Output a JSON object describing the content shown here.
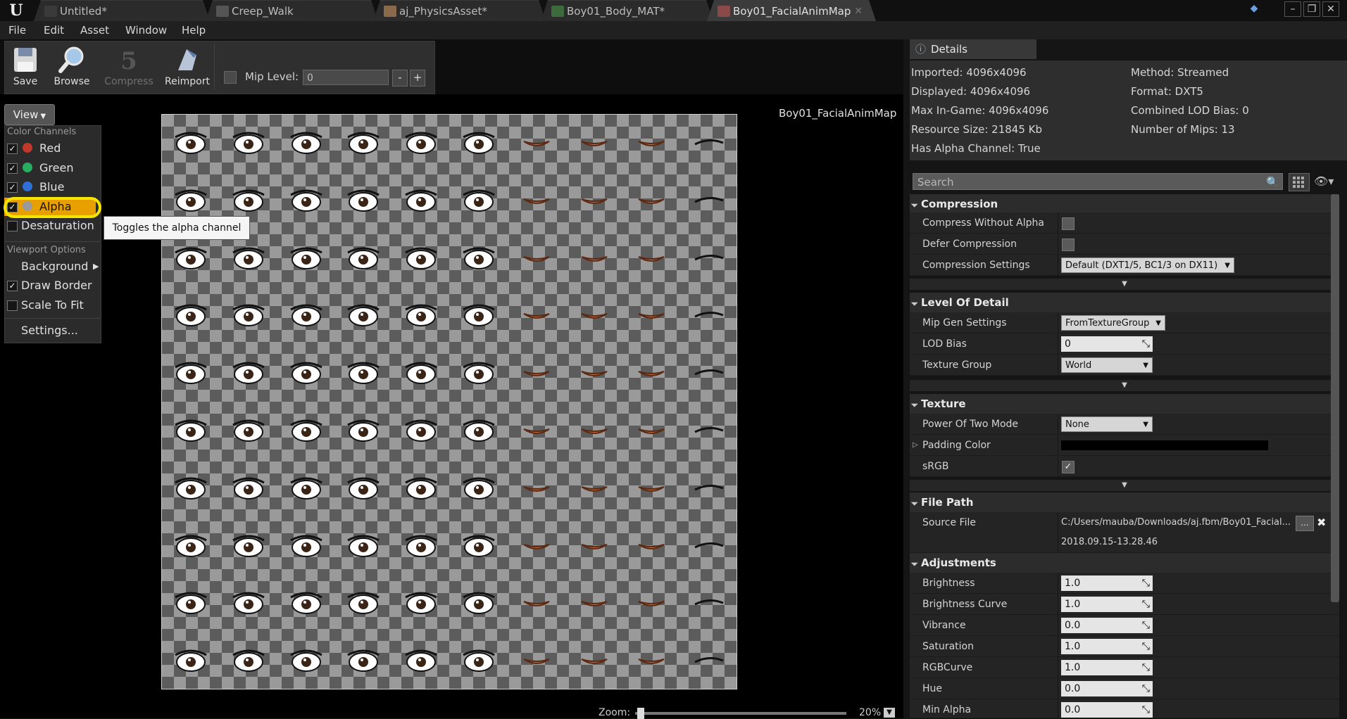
{
  "tabs": [
    {
      "label": "Untitled*"
    },
    {
      "label": "Creep_Walk"
    },
    {
      "label": "aj_PhysicsAsset*"
    },
    {
      "label": "Boy01_Body_MAT*"
    },
    {
      "label": "Boy01_FacialAnimMap"
    }
  ],
  "menu": {
    "file": "File",
    "edit": "Edit",
    "asset": "Asset",
    "window": "Window",
    "help": "Help"
  },
  "toolbar": {
    "save": "Save",
    "browse": "Browse",
    "compress": "Compress",
    "reimport": "Reimport",
    "mip_label": "Mip Level:",
    "mip_value": "0",
    "minus": "-",
    "plus": "+"
  },
  "viewport": {
    "title": "Boy01_FacialAnimMap",
    "view_button": "View",
    "zoom_label": "Zoom:",
    "zoom_value": "20%",
    "zoom_fraction": 0.2
  },
  "view_menu": {
    "color_channels_header": "Color Channels",
    "red": "Red",
    "green": "Green",
    "blue": "Blue",
    "alpha": "Alpha",
    "desaturation": "Desaturation",
    "viewport_options_header": "Viewport Options",
    "background": "Background",
    "draw_border": "Draw Border",
    "scale_to_fit": "Scale To Fit",
    "settings": "Settings...",
    "tooltip": "Toggles the alpha channel",
    "channel_colors": {
      "red": "#c0392b",
      "green": "#27ae60",
      "blue": "#2f6fd6",
      "alpha": "#9a9a9a"
    }
  },
  "details": {
    "tab": "Details",
    "info": {
      "imported": "Imported: 4096x4096",
      "displayed": "Displayed: 4096x4096",
      "max_in_game": "Max In-Game: 4096x4096",
      "resource_size": "Resource Size: 21845 Kb",
      "has_alpha": "Has Alpha Channel: True",
      "method": "Method: Streamed",
      "format": "Format: DXT5",
      "lod_bias": "Combined LOD Bias: 0",
      "num_mips": "Number of Mips: 13"
    },
    "search_placeholder": "Search",
    "compression": {
      "header": "Compression",
      "compress_without_alpha": "Compress Without Alpha",
      "defer_compression": "Defer Compression",
      "compression_settings": "Compression Settings",
      "compression_settings_value": "Default (DXT1/5, BC1/3 on DX11)"
    },
    "lod": {
      "header": "Level Of Detail",
      "mip_gen": "Mip Gen Settings",
      "mip_gen_value": "FromTextureGroup",
      "lod_bias": "LOD Bias",
      "lod_bias_value": "0",
      "texture_group": "Texture Group",
      "texture_group_value": "World"
    },
    "texture": {
      "header": "Texture",
      "pot_mode": "Power Of Two Mode",
      "pot_value": "None",
      "padding_color": "Padding Color",
      "padding_color_hex": "#000000",
      "srgb": "sRGB"
    },
    "file_path": {
      "header": "File Path",
      "source_file": "Source File",
      "source_value": "C:/Users/mauba/Downloads/aj.fbm/Boy01_Facial...",
      "browse": "...",
      "timestamp": "2018.09.15-13.28.46"
    },
    "adjustments": {
      "header": "Adjustments",
      "brightness": "Brightness",
      "brightness_value": "1.0",
      "brightness_curve": "Brightness Curve",
      "brightness_curve_value": "1.0",
      "vibrance": "Vibrance",
      "vibrance_value": "0.0",
      "saturation": "Saturation",
      "saturation_value": "1.0",
      "rgbcurve": "RGBCurve",
      "rgbcurve_value": "1.0",
      "hue": "Hue",
      "hue_value": "0.0",
      "min_alpha": "Min Alpha",
      "min_alpha_value": "0.0"
    }
  }
}
